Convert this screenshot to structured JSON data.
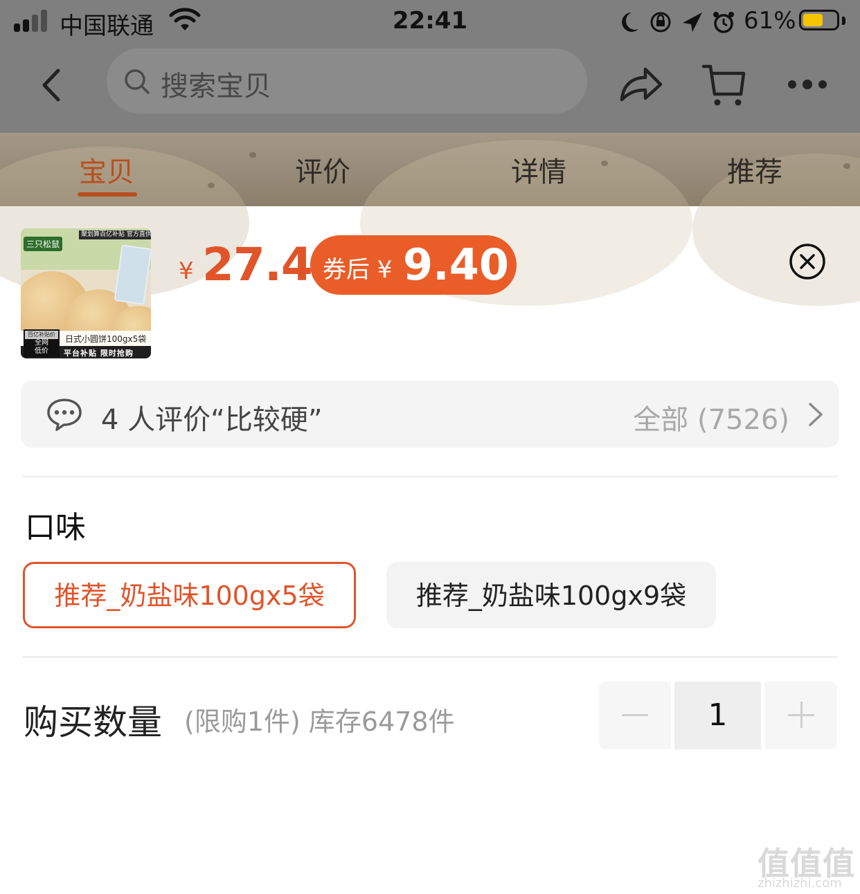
{
  "status_bar": {
    "carrier": "中国联通",
    "time": "22:41",
    "battery_percent": "61%",
    "battery_level": 0.61
  },
  "nav": {
    "search_placeholder": "搜索宝贝"
  },
  "tabs": [
    {
      "label": "宝贝",
      "active": true
    },
    {
      "label": "评价",
      "active": false
    },
    {
      "label": "详情",
      "active": false
    },
    {
      "label": "推荐",
      "active": false
    }
  ],
  "product": {
    "thumb": {
      "brand": "三只松鼠",
      "top_text": "聚划算百亿补贴 官方直供",
      "caption": "日式小圆饼100gx5袋",
      "badge_line1": "百亿补贴价",
      "badge_line2": "全网",
      "badge_line3": "低价",
      "footer": "平台补贴 限时抢购"
    },
    "currency": "¥",
    "price": "27.4",
    "coupon_label": "券后 ¥",
    "coupon_price": "9.40"
  },
  "review": {
    "summary": "4 人评价“比较硬”",
    "all_label": "全部 (7526)"
  },
  "flavor": {
    "title": "口味",
    "options": [
      {
        "label": "推荐_奶盐味100gx5袋",
        "selected": true
      },
      {
        "label": "推荐_奶盐味100gx9袋",
        "selected": false
      }
    ]
  },
  "quantity": {
    "title": "购买数量",
    "note": "(限购1件) 库存6478件",
    "value": "1"
  },
  "watermark": {
    "logo": "值值值",
    "url": "zhizhizhi.com"
  },
  "colors": {
    "accent": "#e0542a",
    "coupon_bg": "#ea5d28",
    "active_tab": "#b94e1d"
  }
}
